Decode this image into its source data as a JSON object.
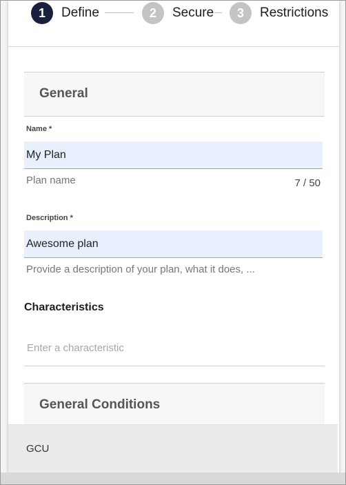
{
  "stepper": {
    "steps": [
      {
        "number": "1",
        "label": "Define",
        "active": true
      },
      {
        "number": "2",
        "label": "Secure",
        "active": false
      },
      {
        "number": "3",
        "label": "Restrictions",
        "active": false
      }
    ]
  },
  "form": {
    "general": {
      "title": "General",
      "name": {
        "label": "Name *",
        "value": "My Plan",
        "hint": "Plan name",
        "counter": "7 / 50"
      },
      "description": {
        "label": "Description *",
        "value": "Awesome plan",
        "hint": "Provide a description of your plan, what it does, ..."
      }
    },
    "characteristics": {
      "title": "Characteristics",
      "placeholder": "Enter a characteristic"
    },
    "general_conditions": {
      "title": "General Conditions",
      "gcu_label": "GCU"
    }
  },
  "colors": {
    "active_step": "#1a1f3c",
    "inactive_step": "#c4c4c4",
    "input_bg": "#e8f0fe"
  }
}
